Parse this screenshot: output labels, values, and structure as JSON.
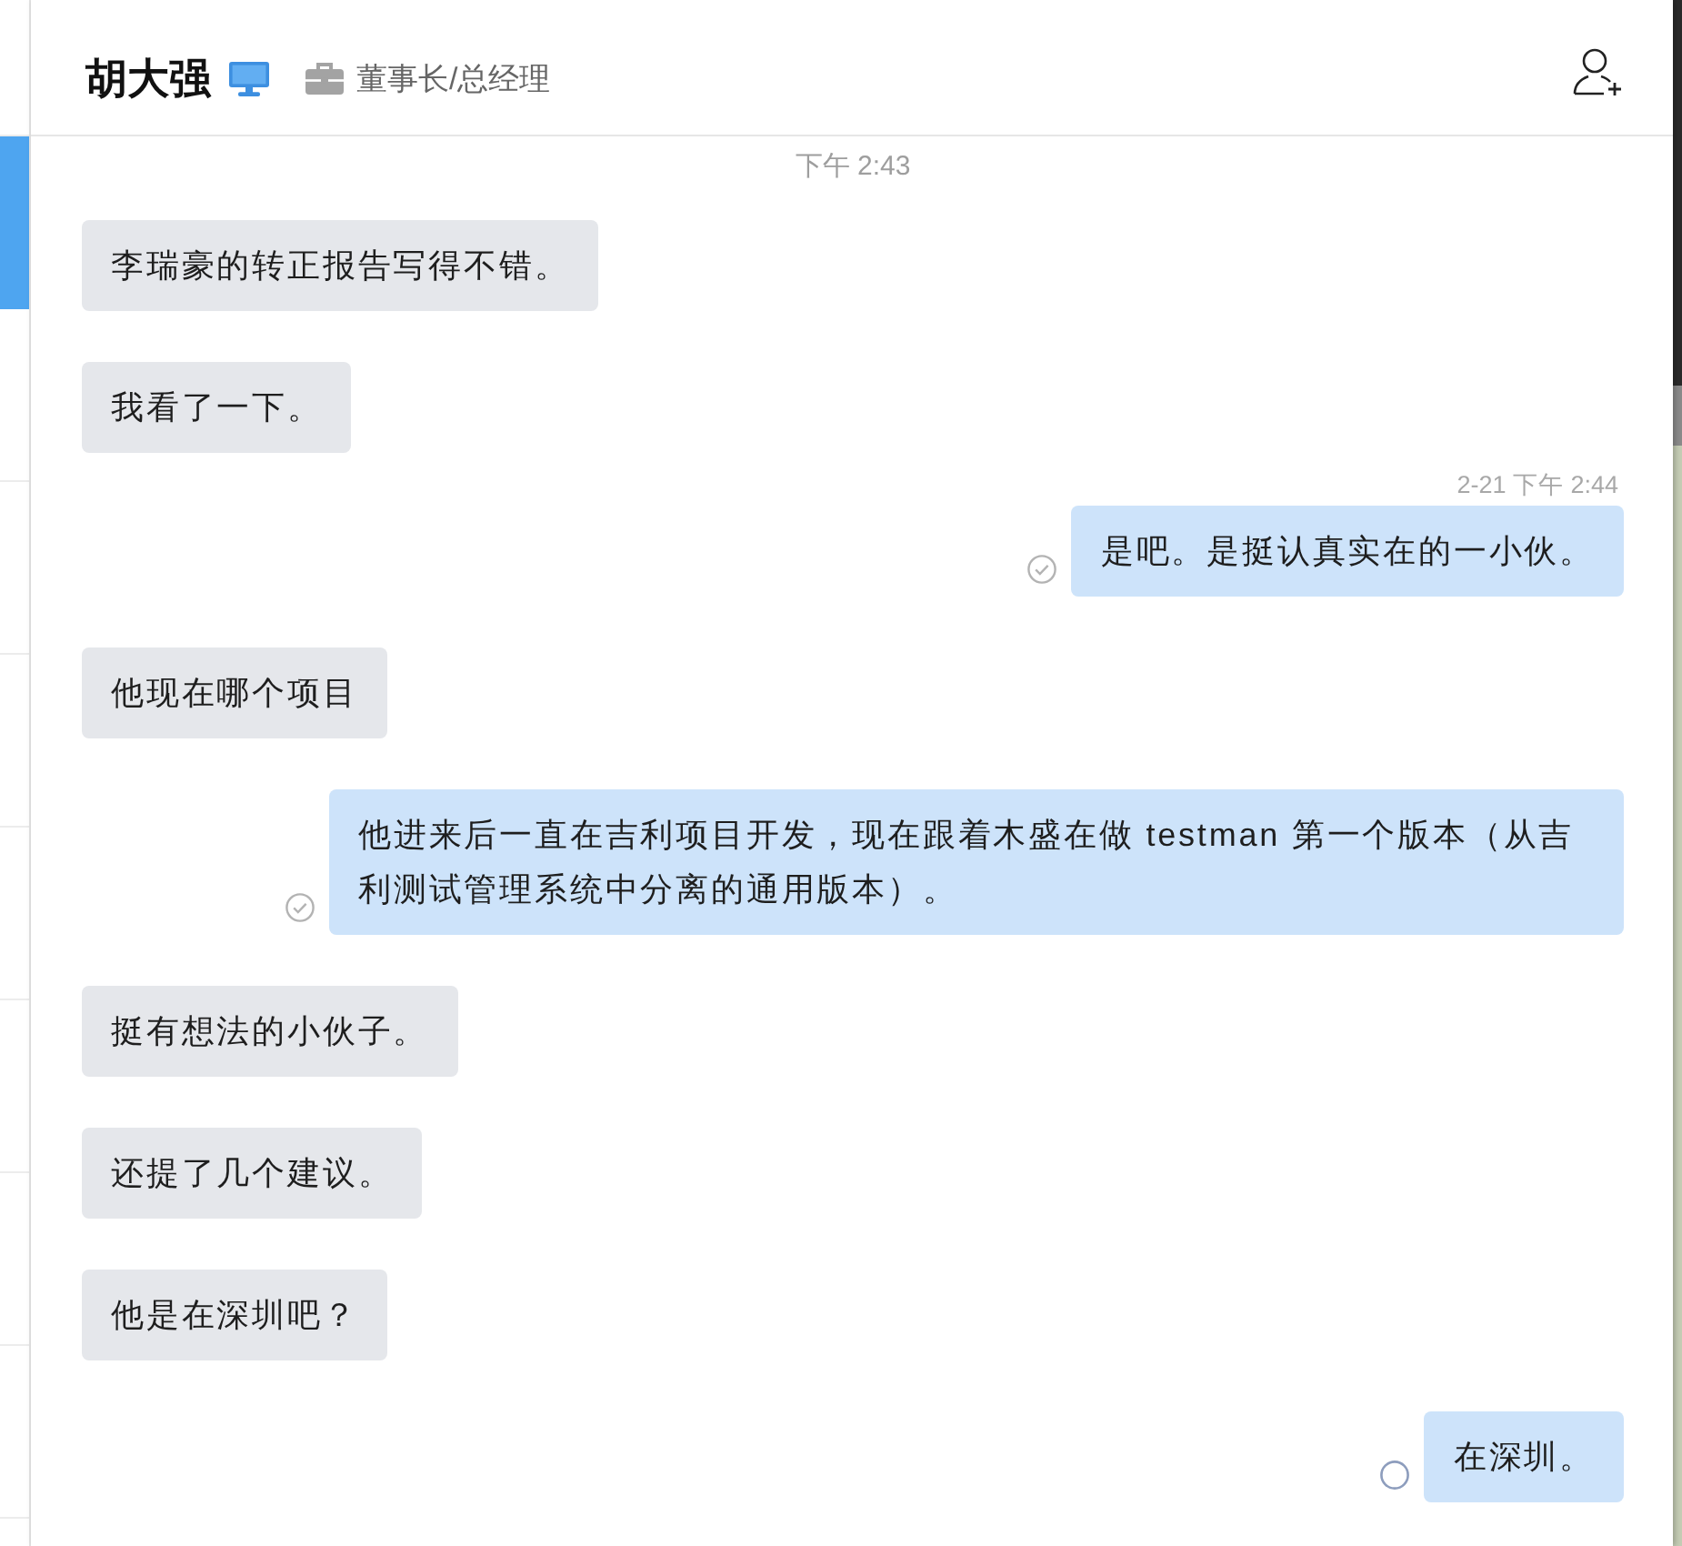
{
  "sidebar": {
    "items": [
      {
        "selected": false
      },
      {
        "selected": true
      },
      {
        "selected": false
      },
      {
        "selected": false
      },
      {
        "selected": false
      },
      {
        "selected": false
      },
      {
        "selected": false
      },
      {
        "selected": false
      },
      {
        "selected": false
      }
    ]
  },
  "header": {
    "name": "胡大强",
    "title": "董事长/总经理"
  },
  "messages": [
    {
      "kind": "timestamp",
      "text": "下午 2:43"
    },
    {
      "kind": "incoming",
      "text": "李瑞豪的转正报告写得不错。"
    },
    {
      "kind": "incoming",
      "text": "我看了一下。"
    },
    {
      "kind": "outgoing",
      "time": "2-21 下午 2:44",
      "text": "是吧。是挺认真实在的一小伙。",
      "read": true
    },
    {
      "kind": "incoming",
      "text": "他现在哪个项目"
    },
    {
      "kind": "outgoing",
      "text": "他进来后一直在吉利项目开发，现在跟着木盛在做 testman 第一个版本（从吉利测试管理系统中分离的通用版本）。",
      "read": true
    },
    {
      "kind": "incoming",
      "text": "挺有想法的小伙子。"
    },
    {
      "kind": "incoming",
      "text": "还提了几个建议。"
    },
    {
      "kind": "incoming",
      "text": "他是在深圳吧？"
    },
    {
      "kind": "outgoing",
      "text": "在深圳。",
      "read": false
    }
  ]
}
